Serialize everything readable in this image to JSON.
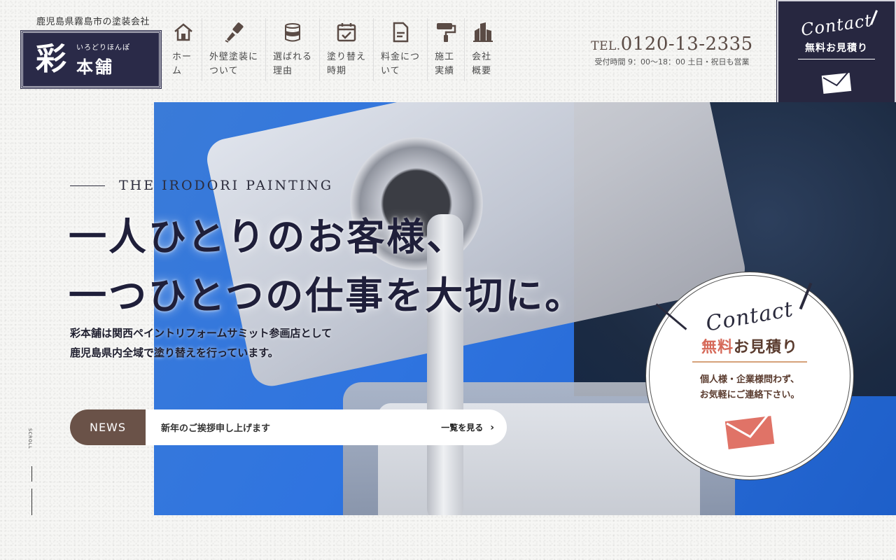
{
  "header": {
    "tagline": "鹿児島県霧島市の塗装会社",
    "logo": {
      "kanji": "彩",
      "kana": "いろどりほんぽ",
      "name": "本舗"
    },
    "nav": [
      {
        "label": "ホー\nム",
        "icon": "home-icon"
      },
      {
        "label": "外壁塗装に\nついて",
        "icon": "paint-brush-icon"
      },
      {
        "label": "選ばれる\n理由",
        "icon": "paint-can-icon"
      },
      {
        "label": "塗り替え\n時期",
        "icon": "calendar-check-icon"
      },
      {
        "label": "料金につ\nいて",
        "icon": "document-icon"
      },
      {
        "label": "施工\n実績",
        "icon": "paint-roller-icon"
      },
      {
        "label": "会社\n概要",
        "icon": "building-icon"
      }
    ],
    "tel": {
      "prefix": "TEL.",
      "number": "0120-13-2335",
      "hours": "受付時間 9：00〜18：00 土日・祝日も営業"
    },
    "contact": {
      "script": "Contact",
      "label": "無料お見積り",
      "icon": "mail-icon"
    }
  },
  "hero": {
    "eyebrow": "THE IRODORI PAINTING",
    "headline": [
      "一人ひとりのお客様、",
      "一つひとつの仕事を大切に。"
    ],
    "lead": [
      "彩本舗は関西ペイントリフォームサミット参画店として",
      "鹿児島県内全域で塗り替えを行っています。"
    ]
  },
  "news": {
    "tag": "NEWS",
    "title": "新年のご挨拶申し上げます",
    "more": "一覧を見る"
  },
  "scroll": {
    "label": "SCROLL"
  },
  "circle_cta": {
    "script": "Contact",
    "title_red": "無料",
    "title_dark": "お見積り",
    "sub": [
      "個人様・企業様問わず、",
      "お気軽にご連絡下さい。"
    ],
    "icon": "mail-icon"
  },
  "colors": {
    "navy": "#272740",
    "brown": "#6a5248",
    "accent_red": "#d66a5a",
    "tel": "#5a4b45"
  }
}
